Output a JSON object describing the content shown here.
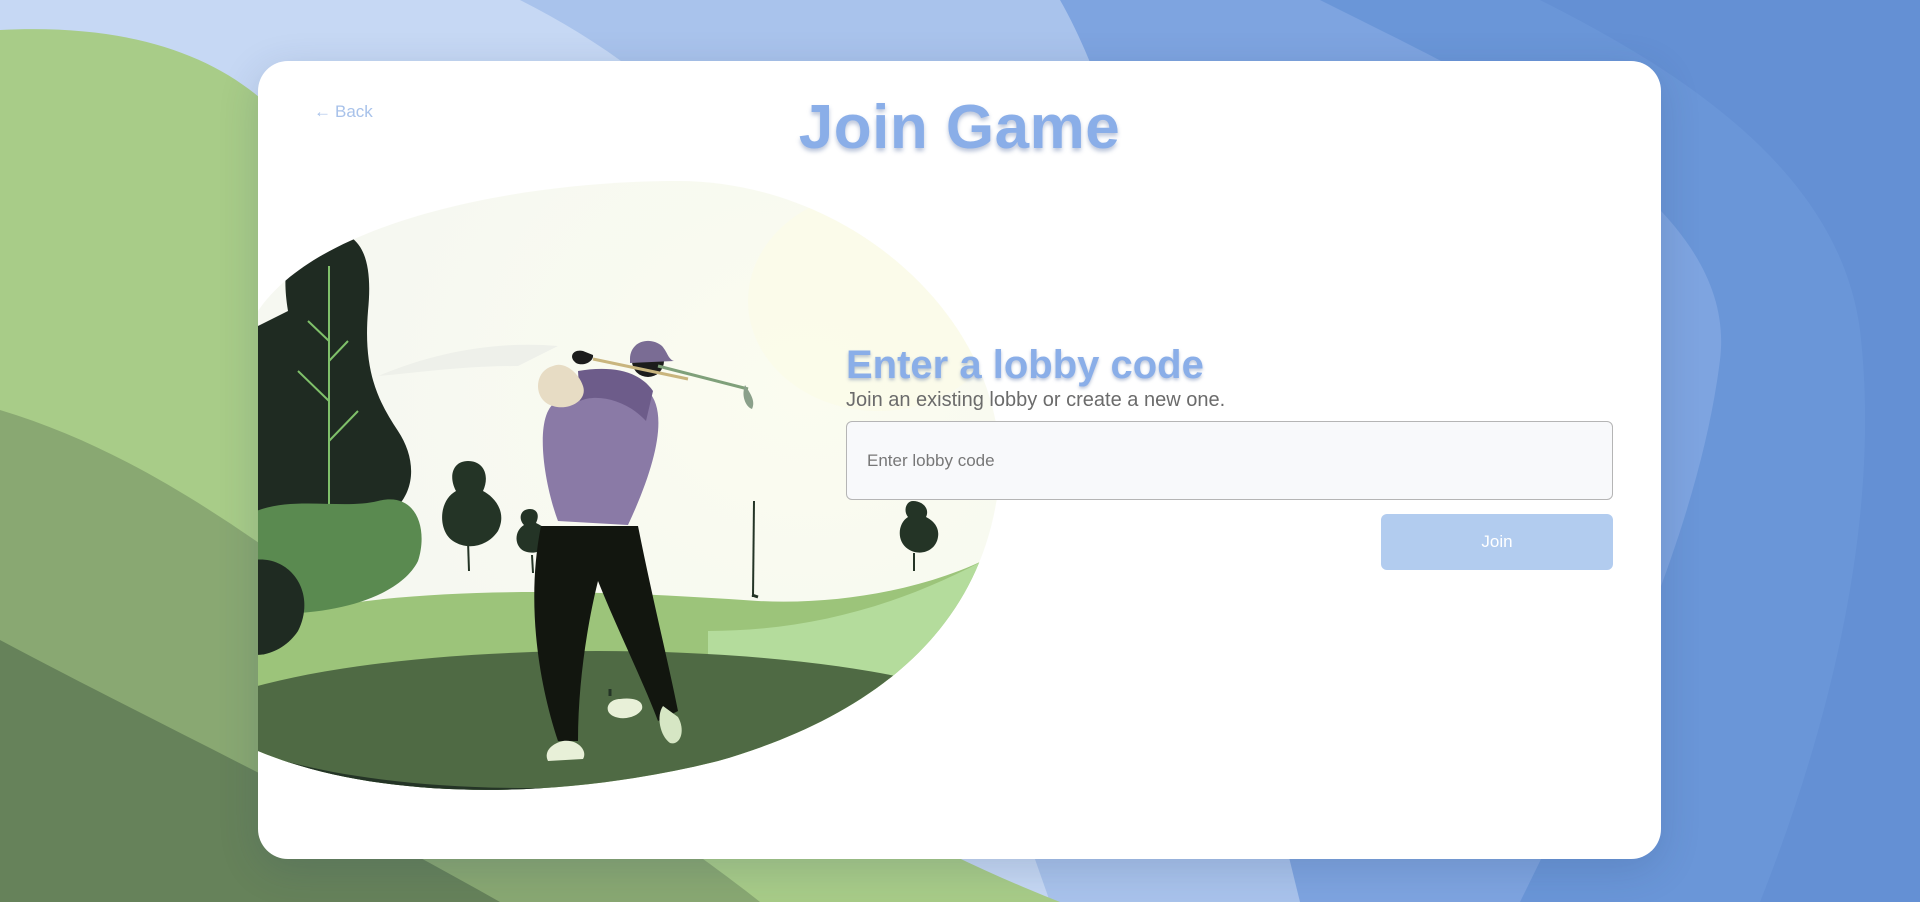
{
  "header": {
    "back_label": "Back",
    "back_arrow": "←",
    "title": "Join Game"
  },
  "form": {
    "heading": "Enter a lobby code",
    "subheading": "Join an existing lobby or create a new one.",
    "input_placeholder": "Enter lobby code",
    "input_value": "",
    "join_label": "Join"
  },
  "colors": {
    "accent": "#8aaee8",
    "button": "#b2ccef",
    "background_blue": "#6a96d8",
    "background_green": "#a8cc88"
  }
}
